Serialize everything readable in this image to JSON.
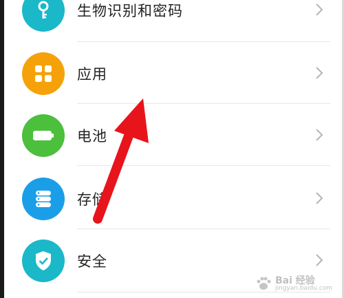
{
  "colors": {
    "biometrics": "#1ab8c8",
    "apps": "#f5a20a",
    "battery": "#4cbf3c",
    "storage": "#1b9ee8",
    "security": "#1ab8c8",
    "arrow": "#e8141c"
  },
  "settings_items": [
    {
      "label": "生物识别和密码",
      "icon": "key-icon"
    },
    {
      "label": "应用",
      "icon": "apps-grid-icon"
    },
    {
      "label": "电池",
      "icon": "battery-icon"
    },
    {
      "label": "存储",
      "icon": "storage-icon"
    },
    {
      "label": "安全",
      "icon": "shield-check-icon"
    }
  ],
  "watermark": {
    "text": "Bai 经验",
    "sub": "jingyan.baidu.com"
  }
}
